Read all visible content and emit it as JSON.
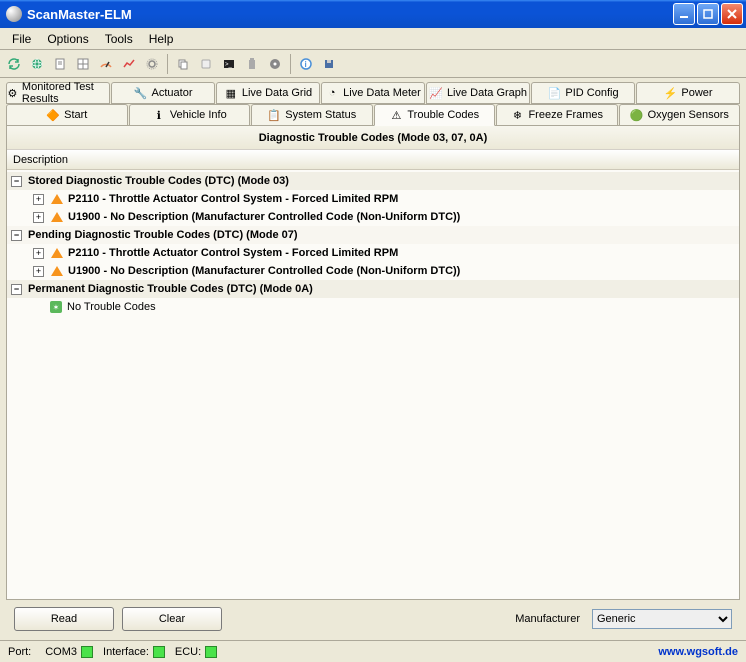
{
  "window": {
    "title": "ScanMaster-ELM"
  },
  "menu": {
    "file": "File",
    "options": "Options",
    "tools": "Tools",
    "help": "Help"
  },
  "tabsRow1": [
    {
      "label": "Monitored Test Results"
    },
    {
      "label": "Actuator"
    },
    {
      "label": "Live Data Grid"
    },
    {
      "label": "Live Data Meter"
    },
    {
      "label": "Live Data Graph"
    },
    {
      "label": "PID Config"
    },
    {
      "label": "Power"
    }
  ],
  "tabsRow2": [
    {
      "label": "Start"
    },
    {
      "label": "Vehicle Info"
    },
    {
      "label": "System Status"
    },
    {
      "label": "Trouble Codes",
      "active": true
    },
    {
      "label": "Freeze Frames"
    },
    {
      "label": "Oxygen Sensors"
    }
  ],
  "panel": {
    "title": "Diagnostic Trouble Codes (Mode 03, 07, 0A)",
    "columnHeader": "Description"
  },
  "tree": {
    "g1": {
      "label": "Stored Diagnostic Trouble Codes (DTC) (Mode 03)",
      "c1": "P2110 - Throttle Actuator Control System - Forced Limited RPM",
      "c2": "U1900 - No Description (Manufacturer Controlled Code (Non-Uniform DTC))"
    },
    "g2": {
      "label": "Pending Diagnostic Trouble Codes (DTC) (Mode 07)",
      "c1": "P2110 - Throttle Actuator Control System - Forced Limited RPM",
      "c2": "U1900 - No Description (Manufacturer Controlled Code (Non-Uniform DTC))"
    },
    "g3": {
      "label": "Permanent Diagnostic Trouble Codes (DTC) (Mode 0A)",
      "c1": "No Trouble Codes"
    }
  },
  "buttons": {
    "read": "Read",
    "clear": "Clear",
    "manufacturerLabel": "Manufacturer",
    "manufacturerValue": "Generic"
  },
  "status": {
    "portLabel": "Port:",
    "portValue": "COM3",
    "interfaceLabel": "Interface:",
    "ecuLabel": "ECU:",
    "url": "www.wgsoft.de"
  }
}
